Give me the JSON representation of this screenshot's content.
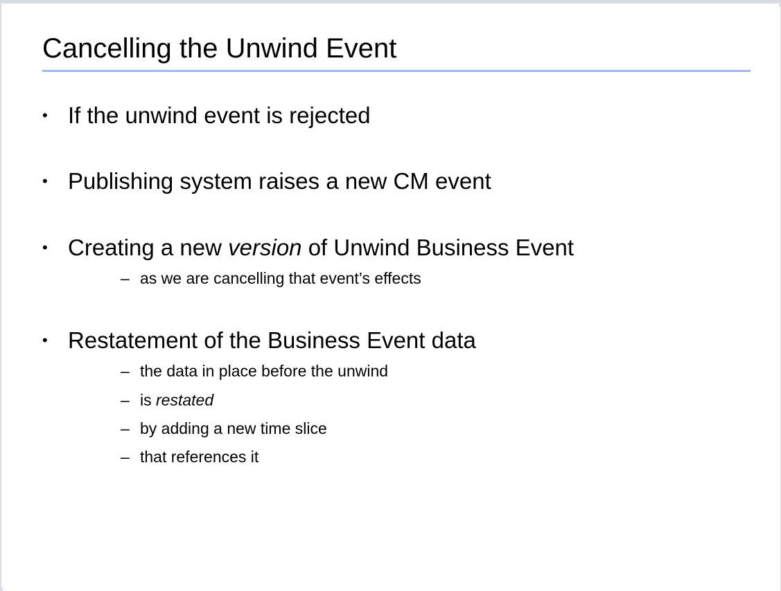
{
  "slide": {
    "title": "Cancelling the Unwind Event",
    "bullets": [
      {
        "text": "If the unwind event is rejected"
      },
      {
        "text": "Publishing system raises a new CM event"
      },
      {
        "pre": "Creating a new ",
        "emph": "version",
        "post": " of Unwind Business Event",
        "subs": [
          {
            "text": "as we are cancelling that event’s effects"
          }
        ]
      },
      {
        "text": "Restatement of the Business Event data",
        "subs": [
          {
            "text": "the data in place before the unwind"
          },
          {
            "pre": "is ",
            "emph": "restated"
          },
          {
            "text": "by adding a new time slice"
          },
          {
            "text": "that references it"
          }
        ]
      }
    ],
    "bullet_glyph": "•",
    "dash_glyph": "–",
    "accent_rule_color": "#9fb7ee"
  }
}
